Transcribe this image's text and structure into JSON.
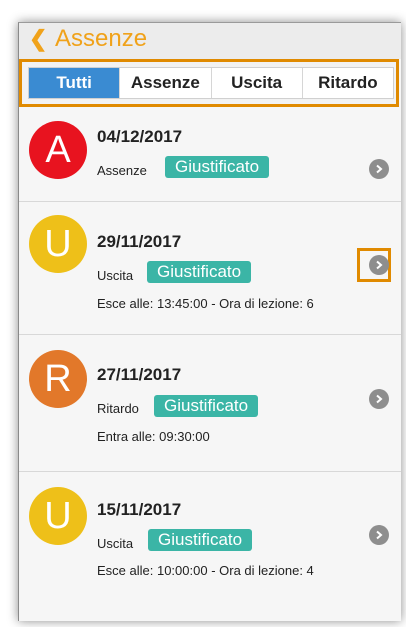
{
  "header": {
    "back_icon": "chevron-left-icon",
    "title": "Assenze"
  },
  "tabs": [
    {
      "label": "Tutti",
      "active": true
    },
    {
      "label": "Assenze",
      "active": false
    },
    {
      "label": "Uscita",
      "active": false
    },
    {
      "label": "Ritardo",
      "active": false
    }
  ],
  "colors": {
    "accent": "#f0a21a",
    "tab_active": "#3a8bd2",
    "badge": "#3bb5a6",
    "assenza": "#e8131f",
    "uscita": "#eec019",
    "ritardo": "#e2782a",
    "highlight": "#e08a00"
  },
  "records": [
    {
      "letter": "A",
      "date": "04/12/2017",
      "type": "Assenze",
      "status": "Giustificato",
      "detail": ""
    },
    {
      "letter": "U",
      "date": "29/11/2017",
      "type": "Uscita",
      "status": "Giustificato",
      "detail": "Esce alle: 13:45:00 - Ora di lezione: 6"
    },
    {
      "letter": "R",
      "date": "27/11/2017",
      "type": "Ritardo",
      "status": "Giustificato",
      "detail": "Entra alle: 09:30:00"
    },
    {
      "letter": "U",
      "date": "15/11/2017",
      "type": "Uscita",
      "status": "Giustificato",
      "detail": "Esce alle: 10:00:00 - Ora di lezione: 4"
    }
  ]
}
